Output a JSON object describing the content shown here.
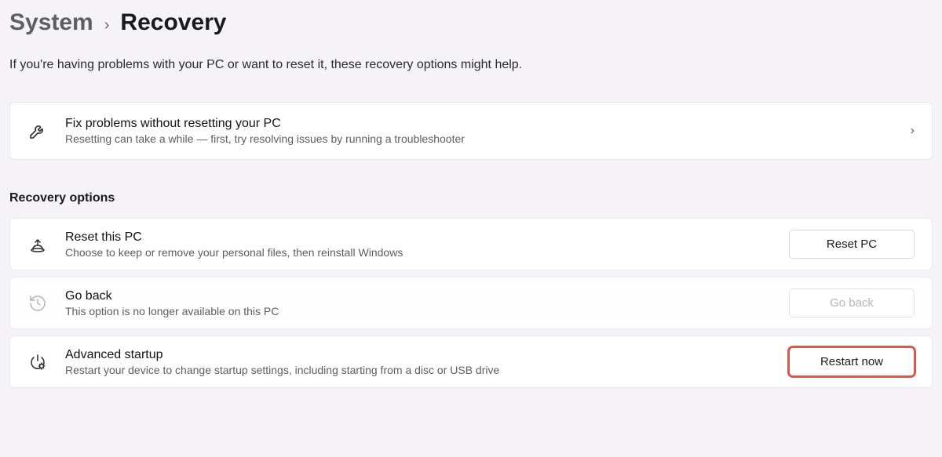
{
  "breadcrumb": {
    "parent": "System",
    "current": "Recovery"
  },
  "intro": "If you're having problems with your PC or want to reset it, these recovery options might help.",
  "troubleshoot": {
    "title": "Fix problems without resetting your PC",
    "sub": "Resetting can take a while — first, try resolving issues by running a troubleshooter"
  },
  "section_title": "Recovery options",
  "reset_pc": {
    "title": "Reset this PC",
    "sub": "Choose to keep or remove your personal files, then reinstall Windows",
    "button": "Reset PC"
  },
  "go_back": {
    "title": "Go back",
    "sub": "This option is no longer available on this PC",
    "button": "Go back"
  },
  "advanced": {
    "title": "Advanced startup",
    "sub": "Restart your device to change startup settings, including starting from a disc or USB drive",
    "button": "Restart now"
  }
}
